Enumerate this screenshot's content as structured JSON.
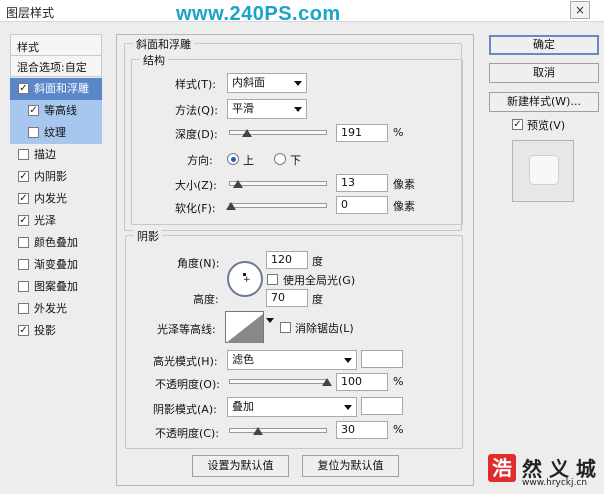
{
  "window": {
    "title": "图层样式",
    "watermark": "www.240PS.com",
    "close_icon": "×"
  },
  "left_panel": {
    "header1": "样式",
    "header2": "混合选项:自定",
    "items": [
      {
        "label": "斜面和浮雕",
        "checked": true
      },
      {
        "label": "等高线",
        "checked": true
      },
      {
        "label": "纹理",
        "checked": false
      },
      {
        "label": "描边",
        "checked": false
      },
      {
        "label": "内阴影",
        "checked": true
      },
      {
        "label": "内发光",
        "checked": true
      },
      {
        "label": "光泽",
        "checked": true
      },
      {
        "label": "颜色叠加",
        "checked": false
      },
      {
        "label": "渐变叠加",
        "checked": false
      },
      {
        "label": "图案叠加",
        "checked": false
      },
      {
        "label": "外发光",
        "checked": false
      },
      {
        "label": "投影",
        "checked": true
      }
    ]
  },
  "bevel": {
    "section_title": "斜面和浮雕",
    "structure_title": "结构",
    "style_label": "样式(T):",
    "style_value": "内斜面",
    "technique_label": "方法(Q):",
    "technique_value": "平滑",
    "depth_label": "深度(D):",
    "depth_value": "191",
    "depth_unit": "%",
    "direction_label": "方向:",
    "direction_up": "上",
    "direction_down": "下",
    "size_label": "大小(Z):",
    "size_value": "13",
    "size_unit": "像素",
    "soften_label": "软化(F):",
    "soften_value": "0",
    "soften_unit": "像素"
  },
  "shading": {
    "title": "阴影",
    "angle_label": "角度(N):",
    "angle_value": "120",
    "angle_unit": "度",
    "global_light": "使用全局光(G)",
    "altitude_label": "高度:",
    "altitude_value": "70",
    "altitude_unit": "度",
    "gloss_label": "光泽等高线:",
    "anti_alias": "消除锯齿(L)",
    "highlight_mode_label": "高光模式(H):",
    "highlight_mode_value": "滤色",
    "highlight_opacity_label": "不透明度(O):",
    "highlight_opacity_value": "100",
    "highlight_opacity_unit": "%",
    "shadow_mode_label": "阴影模式(A):",
    "shadow_mode_value": "叠加",
    "shadow_opacity_label": "不透明度(C):",
    "shadow_opacity_value": "30",
    "shadow_opacity_unit": "%"
  },
  "bottom": {
    "make_default": "设置为默认值",
    "reset_default": "复位为默认值"
  },
  "right_panel": {
    "ok": "确定",
    "cancel": "取消",
    "new_style": "新建样式(W)...",
    "preview": "预览(V)"
  },
  "logo": {
    "mark": "浩",
    "text": "然 义 城",
    "url": "www.hryckj.cn"
  }
}
